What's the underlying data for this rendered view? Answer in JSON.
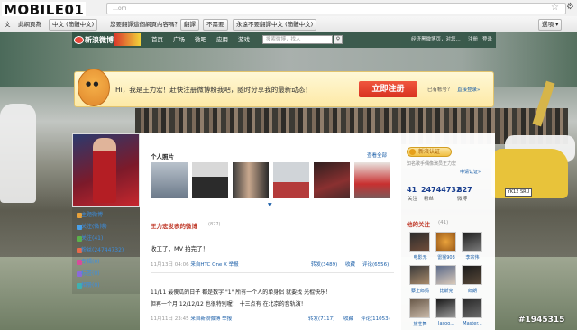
{
  "watermark": "MOBILE01",
  "browser": {
    "url": "…om",
    "translate_prompt": "此網頁為",
    "language_select": "中文 (簡體中文)",
    "translate_question": "您要翻譯這個網頁內容嗎？",
    "translate_btn": "翻譯",
    "no_btn": "不需要",
    "never_btn": "永遠不要翻譯中文 (簡體中文)",
    "options_btn": "選項 ▾"
  },
  "site": {
    "logo": "新浪微博",
    "nav": [
      "首页",
      "广场",
      "微吧",
      "应用",
      "游戏"
    ],
    "search_placeholder": "搜索微博，找人",
    "right_text": "经济黑微博页，对您...",
    "register": "注册",
    "login": "登录"
  },
  "banner": {
    "text": "Hi，我是王力宏！赶快注册微博粉我吧，随时分享我的最新动态！",
    "register_button": "立即注册",
    "have_account": "已有帐号？",
    "login_link": "直接登录»"
  },
  "sidebar": {
    "items": [
      "主题微博",
      "关注(微博)",
      "关注(41)",
      "粉丝(24744732)",
      "专辑(0)",
      "标签(0)",
      "相册(0)"
    ]
  },
  "photos": {
    "title": "个人照片",
    "view_all": "查看全部",
    "more_arrow": "▼"
  },
  "feed": {
    "title": "王力宏发表的微博",
    "count": "(827)",
    "posts": [
      {
        "text": "收工了，MV 拍完了！",
        "time": "11月13日 04:06",
        "source": "来自HTC One X",
        "report": "举报",
        "forward": "转发(3489)",
        "fav": "收藏",
        "comment": "评论(6556)"
      },
      {
        "text": "11/11 最傻瓜的日子 都是数字 \"1\" 所有一个人的单身侣 就要找 光棍快乐！",
        "text2": "但再一个月 12/12/12 也很特别喔！ 十三点有 在北京的音轨演！",
        "time": "11月11日 23:45",
        "source": "来自新浪微博",
        "report": "举报",
        "forward": "转发(7117)",
        "fav": "收藏",
        "comment": "评论(11053)"
      }
    ]
  },
  "right": {
    "verify_badge": "新浪认证",
    "verify_text": "知名歌手偶像演员王力宏",
    "verify_apply": "申请认证»",
    "stats": [
      {
        "num": "41",
        "label": "关注"
      },
      {
        "num": "24744732",
        "label": "粉丝"
      },
      {
        "num": "827",
        "label": "微博"
      }
    ],
    "follows_title": "他的关注",
    "follows_count": "(41)",
    "follows": [
      "电影无",
      "雷猴903",
      "李宗伟",
      "蔡上郎妈",
      "比斯克",
      "郎朗",
      "旅艺舞",
      "Jasoo...",
      "Master..."
    ]
  },
  "car_plate": "YK12 SRU",
  "bid": "#1945315"
}
